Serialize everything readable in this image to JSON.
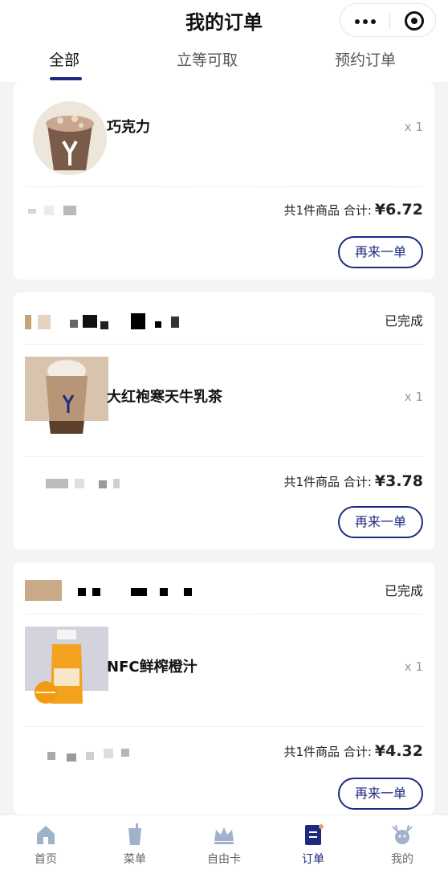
{
  "header": {
    "title": "我的订单"
  },
  "tabs": [
    {
      "label": "全部"
    },
    {
      "label": "立等可取"
    },
    {
      "label": "预约订单"
    }
  ],
  "orders": [
    {
      "status": "",
      "product": "巧克力",
      "qty": "x 1",
      "count_text": "共1件商品 合计:",
      "total": "¥6.72",
      "button": "再来一单"
    },
    {
      "status": "已完成",
      "product": "大红袍寒天牛乳茶",
      "qty": "x 1",
      "count_text": "共1件商品 合计:",
      "total": "¥3.78",
      "button": "再来一单"
    },
    {
      "status": "已完成",
      "product": "NFC鲜榨橙汁",
      "qty": "x 1",
      "count_text": "共1件商品 合计:",
      "total": "¥4.32",
      "button": "再来一单"
    }
  ],
  "bottom_nav": [
    {
      "label": "首页",
      "icon": "home-icon"
    },
    {
      "label": "菜单",
      "icon": "cup-icon"
    },
    {
      "label": "自由卡",
      "icon": "crown-icon"
    },
    {
      "label": "订单",
      "icon": "order-icon",
      "active": true
    },
    {
      "label": "我的",
      "icon": "deer-icon"
    }
  ],
  "colors": {
    "accent": "#1d2a80",
    "background": "#f4f4f4"
  }
}
